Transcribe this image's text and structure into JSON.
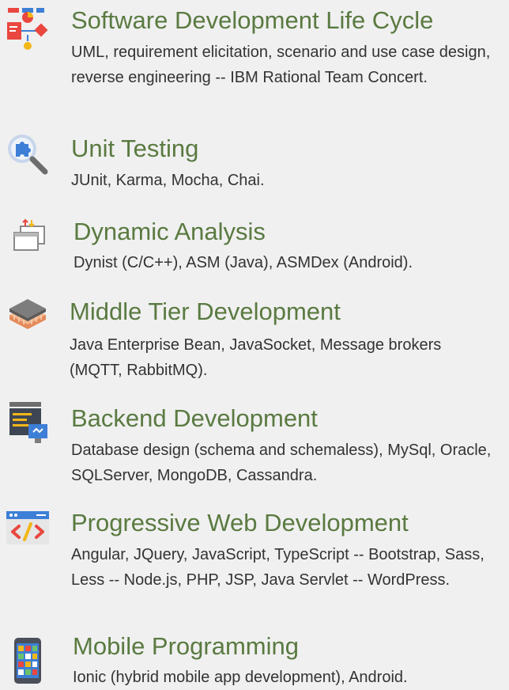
{
  "colors": {
    "background": "#f0f0f0",
    "title": "#5a7a41",
    "text": "#333333"
  },
  "skills": [
    {
      "icon": "flowchart-icon",
      "title": "Software Development Life Cycle",
      "description": "UML, requirement elicitation, scenario and use case design, reverse engineering -- IBM Rational Team Concert."
    },
    {
      "icon": "magnifier-puzzle-icon",
      "title": "Unit Testing",
      "description": "JUnit, Karma, Mocha, Chai."
    },
    {
      "icon": "window-sync-icon",
      "title": "Dynamic Analysis",
      "description": "Dynist (C/C++), ASM (Java), ASMDex (Android)."
    },
    {
      "icon": "layers-icon",
      "title": "Middle Tier Development",
      "description": "Java Enterprise Bean, JavaSocket, Message brokers (MQTT, RabbitMQ)."
    },
    {
      "icon": "server-gear-icon",
      "title": "Backend Development",
      "description": "Database design (schema and schemaless), MySql, Oracle, SQLServer, MongoDB, Cassandra."
    },
    {
      "icon": "code-window-icon",
      "title": "Progressive Web Development",
      "description": "Angular, JQuery, JavaScript, TypeScript -- Bootstrap, Sass, Less -- Node.js, PHP, JSP, Java Servlet -- WordPress."
    },
    {
      "icon": "smartphone-icon",
      "title": "Mobile Programming",
      "description": "Ionic (hybrid mobile app development), Android."
    }
  ]
}
